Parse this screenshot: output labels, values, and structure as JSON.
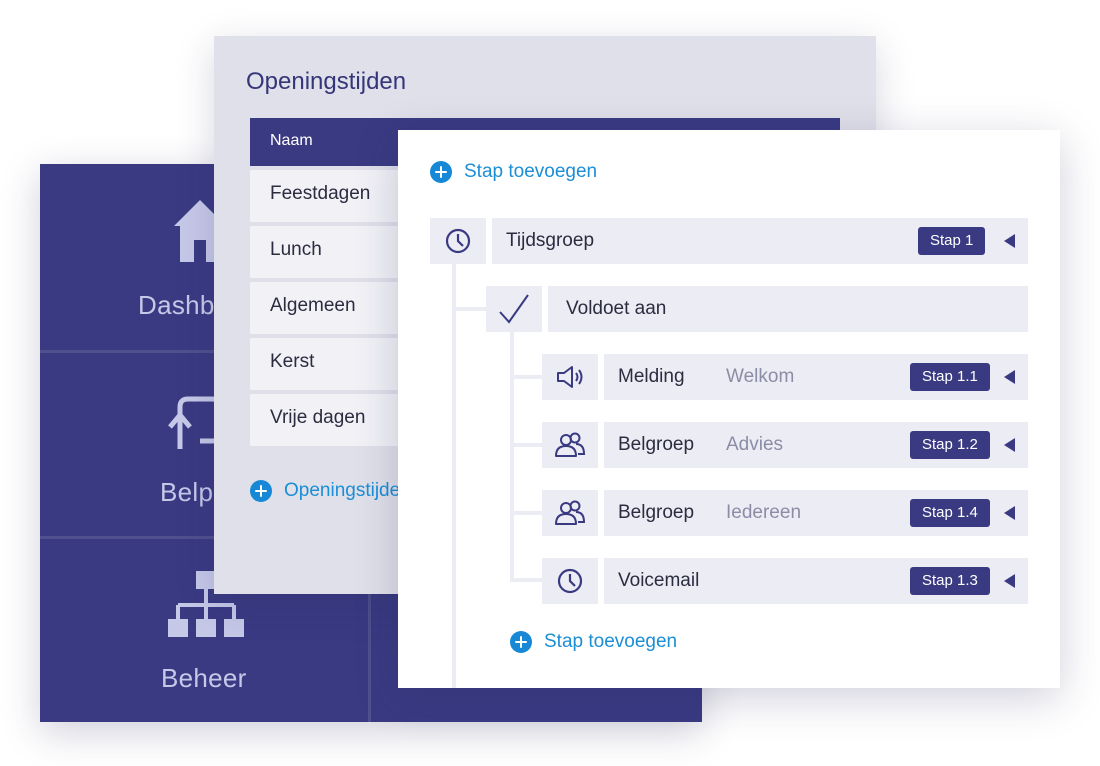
{
  "dashboard": {
    "tiles": [
      {
        "label": "Dashboard",
        "icon": "home-icon"
      },
      {
        "label": "Belplan",
        "icon": "redirect-icon"
      },
      {
        "label": "Beheer",
        "icon": "hierarchy-icon"
      }
    ]
  },
  "hours_panel": {
    "title": "Openingstijden",
    "column_header": "Naam",
    "rows": [
      "Feestdagen",
      "Lunch",
      "Algemeen",
      "Kerst",
      "Vrije dagen"
    ],
    "add_label": "Openingstijden toevoegen"
  },
  "steps_panel": {
    "add_step_top": "Stap toevoegen",
    "root": {
      "title": "Tijdsgroep",
      "badge": "Stap 1",
      "icon": "clock-icon"
    },
    "condition": {
      "title": "Voldoet aan",
      "icon": "checkmark-icon"
    },
    "children": [
      {
        "title": "Melding",
        "sub": "Welkom",
        "badge": "Stap 1.1",
        "icon": "speaker-icon"
      },
      {
        "title": "Belgroep",
        "sub": "Advies",
        "badge": "Stap 1.2",
        "icon": "group-icon"
      },
      {
        "title": "Belgroep",
        "sub": "Iedereen",
        "badge": "Stap 1.4",
        "icon": "group-icon"
      },
      {
        "title": "Voicemail",
        "sub": "",
        "badge": "Stap 1.3",
        "icon": "clock-icon"
      }
    ],
    "add_step_bottom": "Stap toevoegen"
  },
  "colors": {
    "primary": "#3a3a83",
    "accent_link": "#1b8ed6",
    "panel_gray": "#dfe0e9",
    "row_bg": "#ececf4"
  }
}
